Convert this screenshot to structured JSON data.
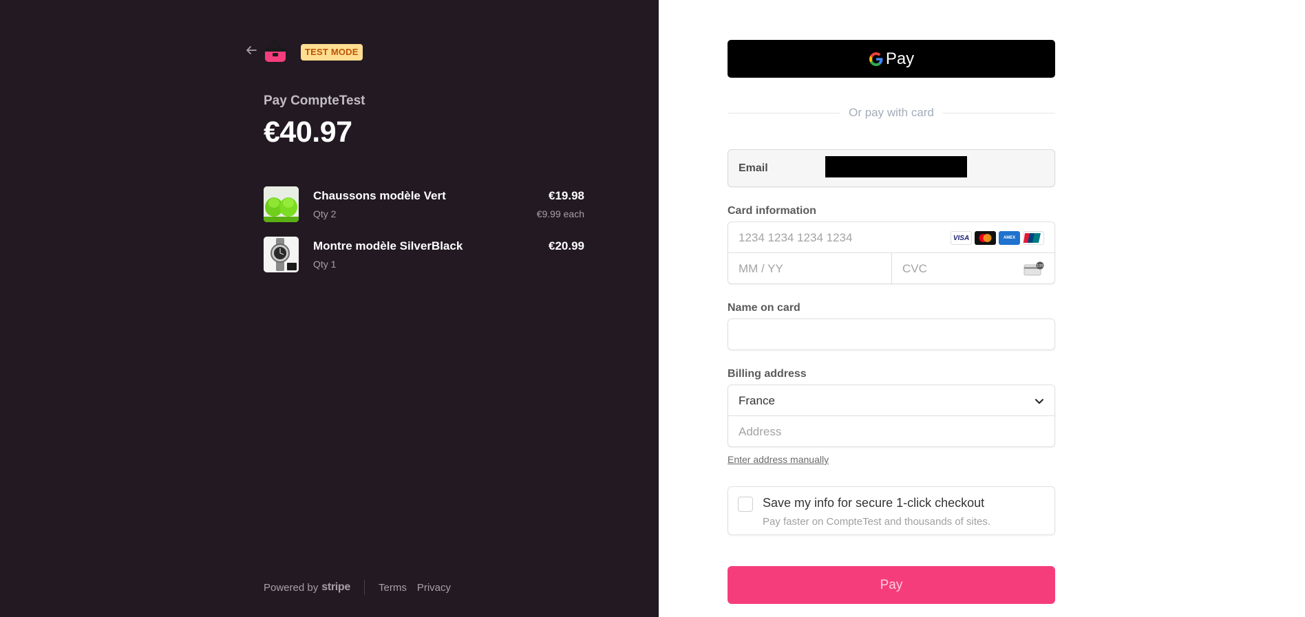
{
  "header": {
    "badge": "TEST MODE",
    "pay_to": "Pay CompteTest",
    "total": "€40.97"
  },
  "items": [
    {
      "name": "Chaussons modèle Vert",
      "qty": "Qty 2",
      "price": "€19.98",
      "unit_price": "€9.99 each"
    },
    {
      "name": "Montre modèle SilverBlack",
      "qty": "Qty 1",
      "price": "€20.99",
      "unit_price": ""
    }
  ],
  "footer": {
    "powered_by": "Powered by",
    "brand": "stripe",
    "terms": "Terms",
    "privacy": "Privacy"
  },
  "gpay": {
    "label": "Pay"
  },
  "divider": "Or pay with card",
  "email": {
    "label": "Email"
  },
  "card": {
    "label": "Card information",
    "number_placeholder": "1234 1234 1234 1234",
    "exp_placeholder": "MM / YY",
    "cvc_placeholder": "CVC",
    "brands": [
      "VISA",
      "Mastercard",
      "AMEX",
      "UnionPay"
    ]
  },
  "name_on_card": {
    "label": "Name on card",
    "value": ""
  },
  "billing": {
    "label": "Billing address",
    "country": "France",
    "address_placeholder": "Address",
    "manual_link": "Enter address manually"
  },
  "save_info": {
    "title": "Save my info for secure 1-click checkout",
    "subtitle": "Pay faster on CompteTest and thousands of sites.",
    "checked": false
  },
  "pay_button": {
    "label": "Pay"
  },
  "colors": {
    "left_bg": "#221922",
    "accent": "#f53d7c",
    "badge_bg": "#ffde92",
    "badge_text": "#bb5504"
  }
}
